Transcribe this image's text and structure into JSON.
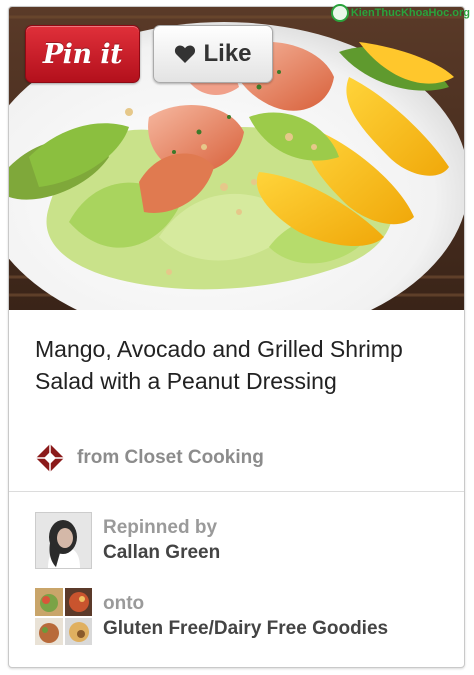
{
  "watermark": {
    "text": "KienThucKhoaHoc.org"
  },
  "pin": {
    "pin_it_label": "Pin it",
    "like_label": "Like",
    "image_icon": "mango-avocado-shrimp-salad-photo",
    "title": "Mango, Avocado and Grilled Shrimp Salad with a Peanut Dressing",
    "source_text": "from Closet Cooking",
    "source_icon": "red-diamond-logo"
  },
  "repin": {
    "label": "Repinned by",
    "user": "Callan Green",
    "avatar_icon": "user-avatar"
  },
  "board": {
    "label": "onto",
    "name": "Gluten Free/Dairy Free Goodies",
    "thumb_icon": "board-thumbnail-grid"
  },
  "colors": {
    "pin_red": "#cc1f2b",
    "label_gray": "#8c8c8c",
    "name_dark": "#444444"
  }
}
